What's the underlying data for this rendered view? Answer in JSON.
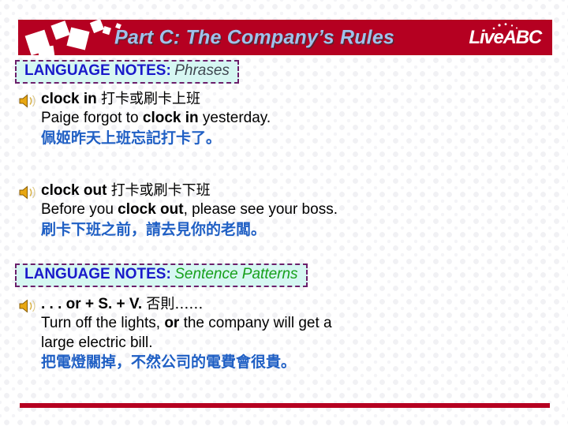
{
  "header": {
    "title": "Part C: The Company’s Rules",
    "logo": "LiveABC",
    "banner_color": "#b50021",
    "title_color": "#9fc2ea"
  },
  "notes_sections": [
    {
      "label": "LANGUAGE NOTES:",
      "kind": "Phrases",
      "kind_color": "#3f4750",
      "label_color": "#1a1aca",
      "box_fill": "#d6f7f2",
      "box_border": "#6b1f6b"
    },
    {
      "label": "LANGUAGE NOTES:",
      "kind": "Sentence Patterns",
      "kind_color": "#17a01c",
      "label_color": "#1a1aca",
      "box_fill": "#d6f7f2",
      "box_border": "#6b1f6b"
    }
  ],
  "entries": [
    {
      "icon": "speaker-icon",
      "term": "clock in",
      "gloss": "打卡或刷卡上班",
      "example_before": "Paige forgot to ",
      "example_bold": "clock in",
      "example_after": " yesterday.",
      "translation": "佩姬昨天上班忘記打卡了。",
      "translation_color": "#1f5fc4"
    },
    {
      "icon": "speaker-icon",
      "term": "clock out",
      "gloss": "打卡或刷卡下班",
      "example_before": "Before you ",
      "example_bold": "clock out",
      "example_after": ", please see your boss.",
      "translation": "刷卡下班之前，請去見你的老闆。",
      "translation_color": "#1f5fc4"
    },
    {
      "icon": "speaker-icon",
      "term": ". . . or + S. + V.",
      "gloss": "否則……",
      "example_before": "Turn off the lights, ",
      "example_bold": "or",
      "example_after": " the company will get a",
      "example_line2": "large electric bill.",
      "translation": "把電燈關掉，不然公司的電費會很貴。",
      "translation_color": "#1f5fc4"
    }
  ],
  "bottom_rule_color": "#b50021"
}
